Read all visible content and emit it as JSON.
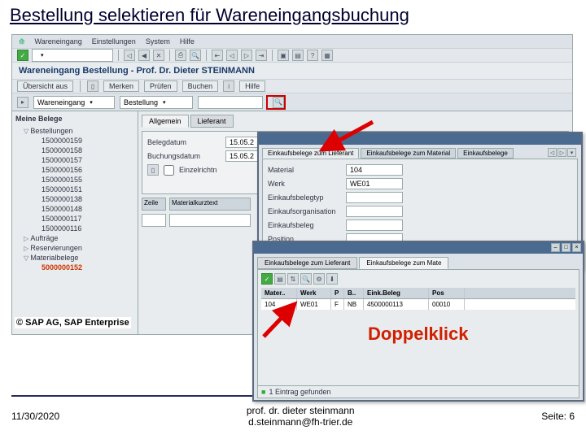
{
  "slide": {
    "title": "Bestellung selektieren für Wareneingangsbuchung"
  },
  "menubar": {
    "items": [
      "Wareneingang",
      "Einstellungen",
      "System",
      "Hilfe"
    ]
  },
  "app": {
    "title": "Wareneingang Bestellung - Prof. Dr. Dieter STEINMANN"
  },
  "toolbar2": {
    "b1": "Übersicht aus",
    "b2": "Merken",
    "b3": "Prüfen",
    "b4": "Buchen",
    "b5": "Hilfe"
  },
  "criteria": {
    "movement": "Wareneingang",
    "ref": "Bestellung"
  },
  "tree": {
    "title": "Meine Belege",
    "root": "Bestellungen",
    "docs": [
      "1500000159",
      "1500000158",
      "1500000157",
      "1500000156",
      "1500000155",
      "1500000151",
      "1500000138",
      "1500000148",
      "1500000117",
      "1500000116"
    ],
    "n2": "Aufträge",
    "n3": "Reservierungen",
    "n4": "Materialbelege",
    "hl": "5000000152"
  },
  "detail": {
    "tab1": "Allgemein",
    "tab2": "Lieferant",
    "f1": "Belegdatum",
    "v1": "15.05.2",
    "f2": "Buchungsdatum",
    "v2": "15.05.2",
    "chk": "Einzelrichtn",
    "gridlbl1": "Zeile",
    "gridlbl2": "Materialkurztext"
  },
  "popup1": {
    "tab1": "Einkaufsbelege zum Lieferant",
    "tab2": "Einkaufsbelege zum Material",
    "tab3": "Einkaufsbelege",
    "f_mat": "Material",
    "v_mat": "104",
    "f_werk": "Werk",
    "v_werk": "WE01",
    "f_typ": "Einkaufsbelegtyp",
    "f_org": "Einkaufsorganisation",
    "f_bel": "Einkaufsbeleg",
    "f_pos": "Position"
  },
  "popup2": {
    "tab1": "Einkaufsbelege zum Lieferant",
    "tab2": "Einkaufsbelege zum Mate",
    "h_mat": "Mater..",
    "h_werk": "Werk",
    "h_p": "P",
    "h_me": "B..",
    "h_beleg": "Eink.Beleg",
    "h_pos": "Pos",
    "r_mat": "104",
    "r_werk": "WE01",
    "r_p": "F",
    "r_me": "NB",
    "r_beleg": "4500000113",
    "r_pos": "00010",
    "status": "1 Eintrag gefunden"
  },
  "annotations": {
    "doubleclick": "Doppelklick"
  },
  "copyright": "© SAP AG, SAP Enterprise",
  "footer": {
    "date": "11/30/2020",
    "author1": "prof. dr. dieter steinmann",
    "author2": "d.steinmann@fh-trier.de",
    "page": "Seite: 6"
  }
}
